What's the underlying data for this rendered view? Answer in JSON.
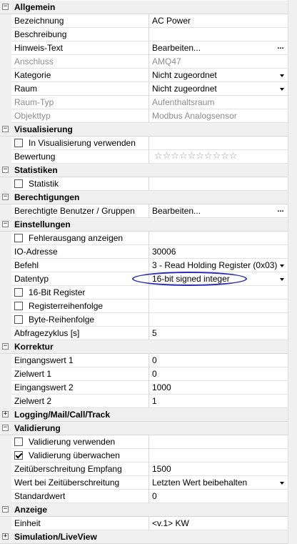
{
  "sections": {
    "allgemein": {
      "title": "Allgemein",
      "rows": [
        {
          "name": "Bezeichnung",
          "value": "AC Power"
        },
        {
          "name": "Beschreibung",
          "value": ""
        },
        {
          "name": "Hinweis-Text",
          "value": "Bearbeiten..."
        },
        {
          "name": "Anschluss",
          "value": "AMQ47"
        },
        {
          "name": "Kategorie",
          "value": "Nicht zugeordnet"
        },
        {
          "name": "Raum",
          "value": "Nicht zugeordnet"
        },
        {
          "name": "Raum-Typ",
          "value": "Aufenthaltsraum"
        },
        {
          "name": "Objekttyp",
          "value": "Modbus Analogsensor"
        }
      ]
    },
    "visualisierung": {
      "title": "Visualisierung",
      "rows": [
        {
          "name": "In Visualisierung verwenden",
          "checked": false
        },
        {
          "name": "Bewertung",
          "rating_stars": "☆☆☆☆☆☆☆☆☆☆"
        }
      ]
    },
    "statistiken": {
      "title": "Statistiken",
      "rows": [
        {
          "name": "Statistik",
          "checked": false
        }
      ]
    },
    "berechtigungen": {
      "title": "Berechtigungen",
      "rows": [
        {
          "name": "Berechtigte Benutzer / Gruppen",
          "value": "Bearbeiten..."
        }
      ]
    },
    "einstellungen": {
      "title": "Einstellungen",
      "rows": [
        {
          "name": "Fehlerausgang anzeigen",
          "checked": false
        },
        {
          "name": "IO-Adresse",
          "value": "30006"
        },
        {
          "name": "Befehl",
          "value": "3 - Read Holding Register (0x03)"
        },
        {
          "name": "Datentyp",
          "value": "16-bit signed integer"
        },
        {
          "name": "16-Bit Register",
          "checked": false
        },
        {
          "name": "Registerreihenfolge",
          "checked": false
        },
        {
          "name": "Byte-Reihenfolge",
          "checked": false
        },
        {
          "name": "Abfragezyklus [s]",
          "value": "5"
        }
      ]
    },
    "korrektur": {
      "title": "Korrektur",
      "rows": [
        {
          "name": "Eingangswert 1",
          "value": "0"
        },
        {
          "name": "Zielwert 1",
          "value": "0"
        },
        {
          "name": "Eingangswert 2",
          "value": "1000"
        },
        {
          "name": "Zielwert 2",
          "value": "1"
        }
      ]
    },
    "logging": {
      "title": "Logging/Mail/Call/Track"
    },
    "validierung": {
      "title": "Validierung",
      "rows": [
        {
          "name": "Validierung verwenden",
          "checked": false
        },
        {
          "name": "Validierung überwachen",
          "checked": true
        },
        {
          "name": "Zeitüberschreitung Empfang",
          "value": "1500"
        },
        {
          "name": "Wert bei Zeitüberschreitung",
          "value": "Letzten Wert beibehalten"
        },
        {
          "name": "Standardwert",
          "value": "0"
        }
      ]
    },
    "anzeige": {
      "title": "Anzeige",
      "rows": [
        {
          "name": "Einheit",
          "value": "<v.1> KW"
        }
      ]
    },
    "simulation": {
      "title": "Simulation/LiveView"
    }
  },
  "expander_symbols": {
    "expanded": "−",
    "collapsed": "+"
  },
  "ellipsis_symbol": "...",
  "colors": {
    "disabled_text": "#8d8d8d",
    "category_bg": "#f0f0f0",
    "highlight": "#2a2ab5"
  }
}
